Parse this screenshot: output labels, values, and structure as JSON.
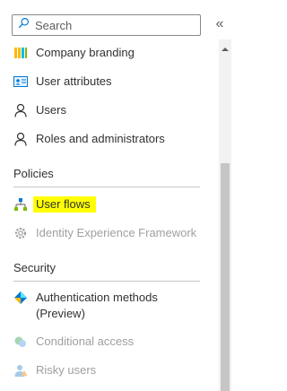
{
  "search": {
    "placeholder": "Search"
  },
  "collapse_glyph": "«",
  "menu": {
    "top_items": [
      {
        "label": "Company branding",
        "icon": "company-branding-icon"
      },
      {
        "label": "User attributes",
        "icon": "user-attributes-icon"
      },
      {
        "label": "Users",
        "icon": "user-icon"
      },
      {
        "label": "Roles and administrators",
        "icon": "roles-icon"
      }
    ],
    "policies": {
      "title": "Policies",
      "items": [
        {
          "label": "User flows",
          "icon": "user-flows-icon",
          "highlighted": true
        },
        {
          "label": "Identity Experience Framework",
          "icon": "gear-icon",
          "disabled": true
        }
      ]
    },
    "security": {
      "title": "Security",
      "items": [
        {
          "label": "Authentication methods",
          "label_line2": "(Preview)",
          "icon": "authentication-methods-icon"
        },
        {
          "label": "Conditional access",
          "icon": "conditional-access-icon",
          "disabled": true
        },
        {
          "label": "Risky users",
          "icon": "risky-users-icon",
          "disabled": true
        }
      ]
    }
  },
  "colors": {
    "highlight": "#ffff00",
    "disabled_text": "#a19f9d",
    "text": "#323130",
    "accent_blue": "#0078d4"
  }
}
